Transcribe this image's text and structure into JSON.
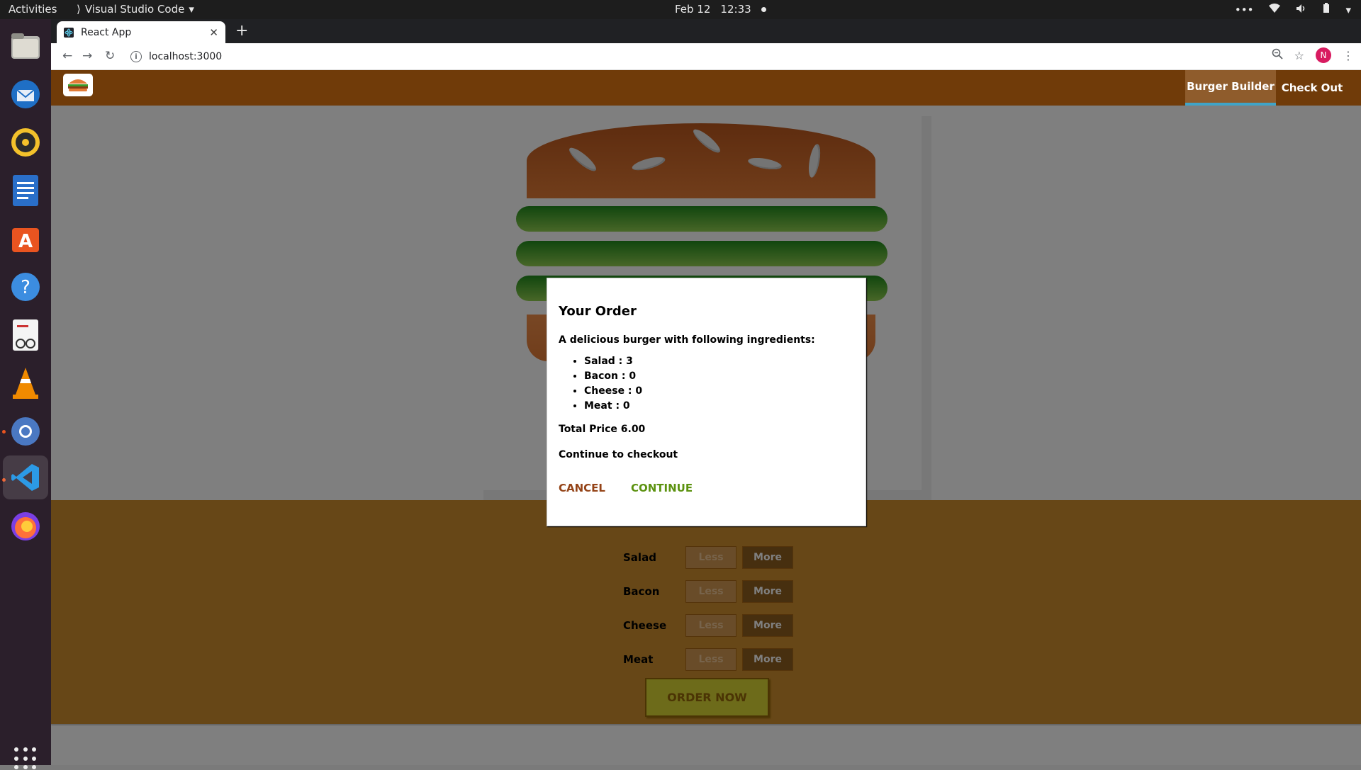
{
  "system": {
    "activities": "Activities",
    "app_menu": "Visual Studio Code",
    "date": "Feb 12",
    "time": "12:33"
  },
  "browser": {
    "tab_title": "React App",
    "url": "localhost:3000",
    "profile_initial": "N"
  },
  "app": {
    "nav": [
      "Burger Builder",
      "Check Out"
    ],
    "controls": [
      {
        "label": "Salad",
        "less": "Less",
        "more": "More"
      },
      {
        "label": "Bacon",
        "less": "Less",
        "more": "More"
      },
      {
        "label": "Cheese",
        "less": "Less",
        "more": "More"
      },
      {
        "label": "Meat",
        "less": "Less",
        "more": "More"
      }
    ],
    "order_button": "ORDER NOW"
  },
  "modal": {
    "title": "Your Order",
    "intro": "A delicious burger with following ingredients:",
    "ingredients": [
      "Salad : 3",
      "Bacon : 0",
      "Cheese : 0",
      "Meat : 0"
    ],
    "total": "Total Price 6.00",
    "continue_prompt": "Continue to checkout",
    "cancel": "CANCEL",
    "continue": "CONTINUE"
  },
  "colors": {
    "toolbar": "#703b09",
    "controls_bg": "#cf8f2e",
    "cancel": "#944317",
    "continue": "#5c9210"
  }
}
